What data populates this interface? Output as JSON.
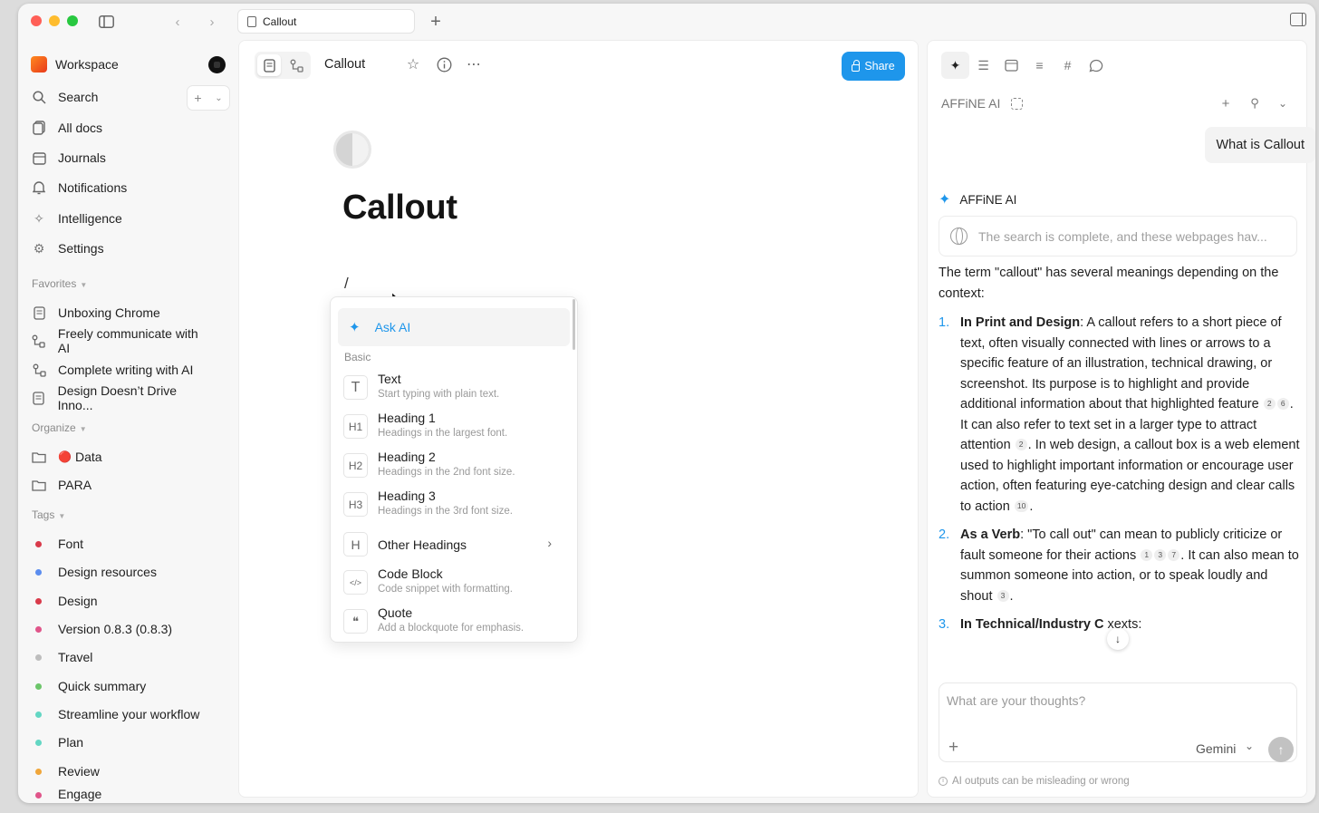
{
  "tab": {
    "title": "Callout"
  },
  "sidebar": {
    "workspace_name": "Workspace",
    "nav": [
      {
        "label": "Search",
        "icon": "search-icon"
      },
      {
        "label": "All docs",
        "icon": "all-docs-icon"
      },
      {
        "label": "Journals",
        "icon": "calendar-icon"
      },
      {
        "label": "Notifications",
        "icon": "bell-icon"
      },
      {
        "label": "Intelligence",
        "icon": "sparkle-icon"
      },
      {
        "label": "Settings",
        "icon": "gear-icon"
      }
    ],
    "favorites_label": "Favorites",
    "favorites": [
      {
        "label": "Unboxing Chrome",
        "icon": "page-icon"
      },
      {
        "label": "Freely communicate with AI",
        "icon": "edgeless-icon"
      },
      {
        "label": "Complete writing with AI",
        "icon": "edgeless-icon"
      },
      {
        "label": "Design Doesn’t Drive Inno...",
        "icon": "page-icon"
      }
    ],
    "organize_label": "Organize",
    "organize": [
      {
        "label": "Data",
        "emoji": "🔴"
      },
      {
        "label": "PARA",
        "emoji": ""
      }
    ],
    "tags_label": "Tags",
    "tags": [
      {
        "label": "Font",
        "color": "#d93a4a"
      },
      {
        "label": "Design resources",
        "color": "#5b8def"
      },
      {
        "label": "Design",
        "color": "#d93a4a"
      },
      {
        "label": "Version 0.8.3 (0.8.3)",
        "color": "#e0558a"
      },
      {
        "label": "Travel",
        "color": "#bdbdbd"
      },
      {
        "label": "Quick summary",
        "color": "#6cc56a"
      },
      {
        "label": "Streamline your workflow",
        "color": "#63d6c3"
      },
      {
        "label": "Plan",
        "color": "#63d6c3"
      },
      {
        "label": "Review",
        "color": "#f0a63a"
      },
      {
        "label": "Engage",
        "color": "#e0558a"
      }
    ]
  },
  "doc": {
    "title_small": "Callout",
    "share_label": "Share",
    "heading": "Callout",
    "typed": "/"
  },
  "slash_menu": {
    "ask_ai": "Ask AI",
    "section": "Basic",
    "items": [
      {
        "icon_text": "T",
        "title": "Text",
        "desc": "Start typing with plain text."
      },
      {
        "icon_text": "H1",
        "title": "Heading 1",
        "desc": "Headings in the largest font."
      },
      {
        "icon_text": "H2",
        "title": "Heading 2",
        "desc": "Headings in the 2nd font size."
      },
      {
        "icon_text": "H3",
        "title": "Heading 3",
        "desc": "Headings in the 3rd font size."
      },
      {
        "icon_text": "H",
        "title": "Other Headings",
        "desc": ""
      },
      {
        "icon_text": "</>",
        "title": "Code Block",
        "desc": "Code snippet with formatting."
      },
      {
        "icon_text": "❝",
        "title": "Quote",
        "desc": "Add a blockquote for emphasis."
      }
    ]
  },
  "ai_panel": {
    "header": "AFFiNE AI",
    "user_message": "What is Callout",
    "assistant_name": "AFFiNE AI",
    "search_note": "The search is complete, and these webpages hav...",
    "intro": "The term \"callout\" has several meanings depending on the context:",
    "list": [
      {
        "num": "1.",
        "bold": "In Print and Design",
        "text_a": ": A callout refers to a short piece of text, often visually connected with lines or arrows to a specific feature of an illustration, technical drawing, or screenshot. Its purpose is to highlight and provide additional information about that highlighted feature",
        "cites_a": [
          "2",
          "6"
        ],
        "text_b": ". It can also refer to text set in a larger type to attract attention",
        "cites_b": [
          "2"
        ],
        "text_c": ". In web design, a callout box is a web element used to highlight important information or encourage user action, often featuring eye-catching design and clear calls to action",
        "cites_c": [
          "10"
        ],
        "text_d": "."
      },
      {
        "num": "2.",
        "bold": "As a Verb",
        "text_a": ": \"To call out\" can mean to publicly criticize or fault someone for their actions",
        "cites_a": [
          "1",
          "3",
          "7"
        ],
        "text_b": ". It can also mean to summon someone into action, or to speak loudly and shout",
        "cites_b": [
          "3"
        ],
        "text_c": ".",
        "cites_c": [],
        "text_d": ""
      },
      {
        "num": "3.",
        "bold": "In Technical/Industry C",
        "text_a": "  xexts:",
        "cites_a": [],
        "text_b": "",
        "cites_b": [],
        "text_c": "",
        "cites_c": [],
        "text_d": ""
      }
    ],
    "input_placeholder": "What are your thoughts?",
    "model": "Gemini",
    "disclaimer": "AI outputs can be misleading or wrong"
  }
}
